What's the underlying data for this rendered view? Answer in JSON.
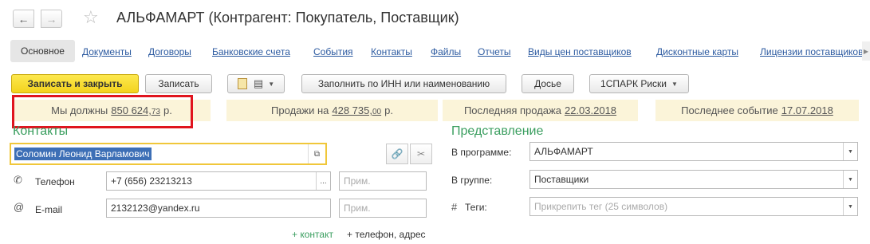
{
  "window": {
    "back_glyph": "←",
    "forward_glyph": "→",
    "favorite_glyph": "☆",
    "title": "АЛЬФАМАРТ (Контрагент: Покупатель, Поставщик)"
  },
  "tabs": [
    {
      "label": "Основное",
      "active": true
    },
    {
      "label": "Документы"
    },
    {
      "label": "Договоры"
    },
    {
      "label": "Банковские счета"
    },
    {
      "label": "События"
    },
    {
      "label": "Контакты"
    },
    {
      "label": "Файлы"
    },
    {
      "label": "Отчеты"
    },
    {
      "label": "Виды цен поставщиков"
    },
    {
      "label": "Дисконтные карты"
    },
    {
      "label": "Лицензии поставщиков"
    }
  ],
  "toolbar": {
    "save_close": "Записать и закрыть",
    "save": "Записать",
    "fill_by_inn": "Заполнить по ИНН или наименованию",
    "dossier": "Досье",
    "spark": "1СПАРК Риски"
  },
  "info": {
    "debt_label": "Мы должны",
    "debt_value_main": "850 624,",
    "debt_value_cents": "73",
    "debt_unit": "р.",
    "sales_label": "Продажи на",
    "sales_value_main": "428 735,",
    "sales_value_cents": "00",
    "sales_unit": "р.",
    "last_sale_label": "Последняя продажа",
    "last_sale_date": "22.03.2018",
    "last_event_label": "Последнее событие",
    "last_event_date": "17.07.2018"
  },
  "contacts": {
    "heading": "Контакты",
    "person": "Соломин Леонид Варламович",
    "phone_label": "Телефон",
    "phone_value": "+7 (656) 23213213",
    "phone_note_placeholder": "Прим.",
    "email_label": "E-mail",
    "email_value": "2132123@yandex.ru",
    "email_note_placeholder": "Прим.",
    "add_contact": "контакт",
    "add_phone_address": "телефон, адрес",
    "plus": "+"
  },
  "representation": {
    "heading": "Представление",
    "in_program_label": "В программе:",
    "in_program_value": "АЛЬФАМАРТ",
    "in_group_label": "В группе:",
    "in_group_value": "Поставщики",
    "tags_label": "Теги:",
    "tags_placeholder": "Прикрепить тег (25 символов)"
  },
  "colors": {
    "accent_green": "#3a9e5f",
    "link_blue": "#2c5aa0",
    "primary_yellow": "#f3d31d",
    "highlight_red": "#e0141e",
    "info_bg": "#fbf4d9"
  }
}
